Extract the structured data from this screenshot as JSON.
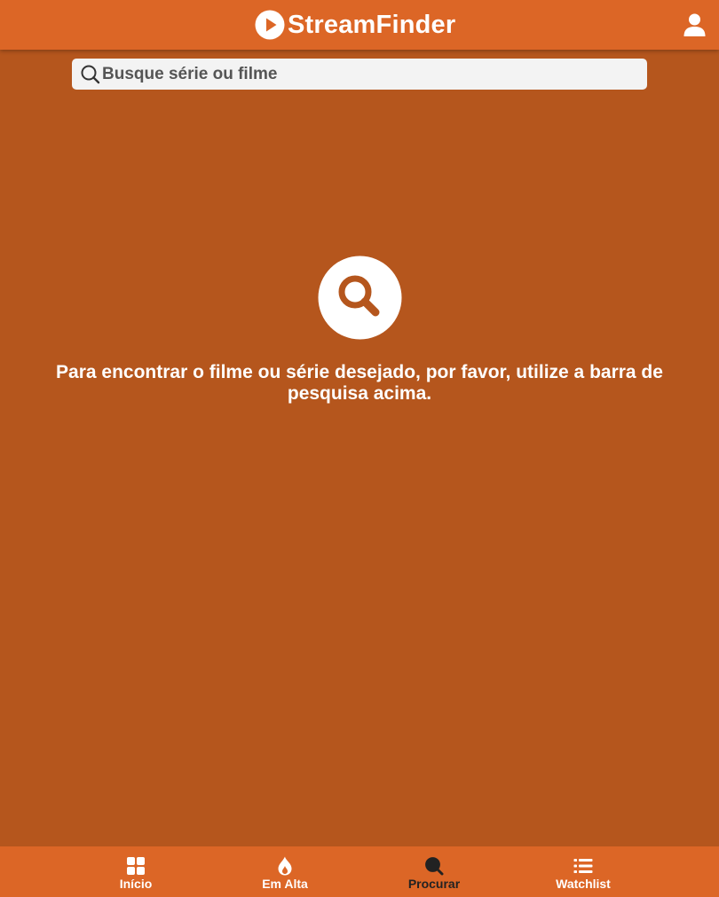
{
  "header": {
    "app_name": "StreamFinder",
    "logo_icon": "play-circle-icon",
    "user_icon": "user-icon"
  },
  "search": {
    "placeholder": "Busque série ou filme",
    "value": "",
    "icon": "search-icon"
  },
  "empty_state": {
    "icon": "search-circle-icon",
    "message": "Para encontrar o filme ou série desejado, por favor, utilize a barra de pesquisa acima."
  },
  "bottom_nav": {
    "items": [
      {
        "label": "Início",
        "icon": "grid-icon",
        "active": false
      },
      {
        "label": "Em Alta",
        "icon": "fire-icon",
        "active": false
      },
      {
        "label": "Procurar",
        "icon": "search-icon",
        "active": true
      },
      {
        "label": "Watchlist",
        "icon": "list-icon",
        "active": false
      }
    ]
  },
  "colors": {
    "header_bg": "#dc6626",
    "page_bg": "#b5561d",
    "active_nav": "#222222",
    "text_light": "#ffffff"
  }
}
